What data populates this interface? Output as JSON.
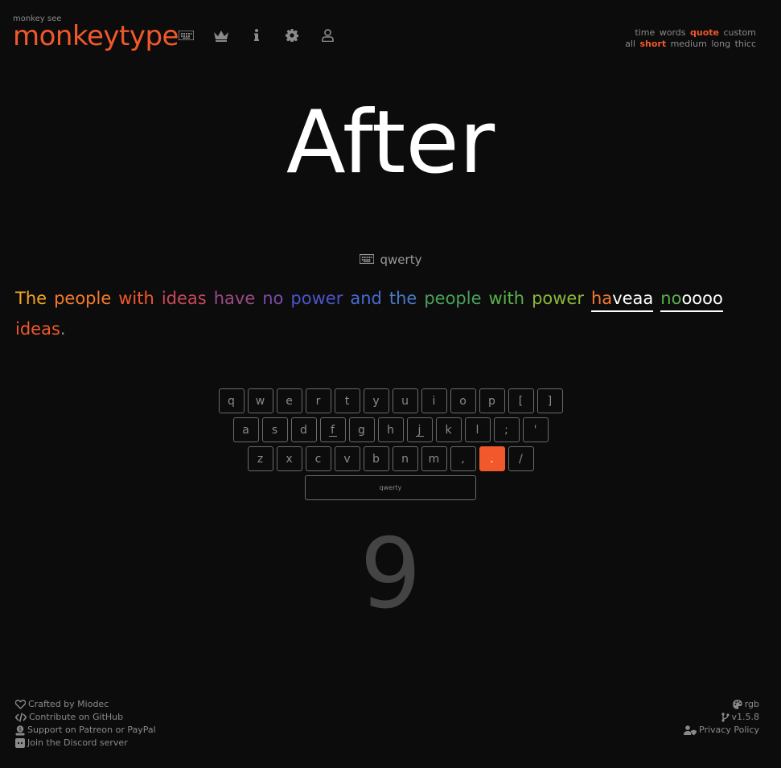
{
  "header": {
    "tagline": "monkey see",
    "logo": "monkeytype",
    "nav": [
      {
        "name": "keyboard-icon"
      },
      {
        "name": "crown-icon"
      },
      {
        "name": "info-icon"
      },
      {
        "name": "gear-icon"
      },
      {
        "name": "user-icon"
      }
    ]
  },
  "config": {
    "modes": [
      "time",
      "words",
      "quote",
      "custom"
    ],
    "active_mode": "quote",
    "lengths": [
      "all",
      "short",
      "medium",
      "long",
      "thicc"
    ],
    "active_length": "short"
  },
  "big_word": "After",
  "layout_label": "qwerty",
  "words": [
    {
      "text": "The",
      "color": "#f5a623"
    },
    {
      "text": "people",
      "color": "#f47a2e"
    },
    {
      "text": "with",
      "color": "#f1582b"
    },
    {
      "text": "ideas",
      "color": "#c8485b"
    },
    {
      "text": "have",
      "color": "#9b4a86"
    },
    {
      "text": "no",
      "color": "#7a4aa6"
    },
    {
      "text": "power",
      "color": "#4a55c8"
    },
    {
      "text": "and",
      "color": "#4a6ad0"
    },
    {
      "text": "the",
      "color": "#4a7ac8"
    },
    {
      "text": "people",
      "color": "#4aa05a"
    },
    {
      "text": "with",
      "color": "#5ab04a"
    },
    {
      "text": "power",
      "color": "#8ab83a"
    }
  ],
  "typed_word_1": {
    "correct": "ha",
    "extra": "veaa"
  },
  "typed_word_2": {
    "correct": "no",
    "extra": "oooo"
  },
  "last_word": "ideas",
  "last_punct": ".",
  "keyboard": {
    "row1": [
      "q",
      "w",
      "e",
      "r",
      "t",
      "y",
      "u",
      "i",
      "o",
      "p",
      "[",
      "]"
    ],
    "row2": [
      "a",
      "s",
      "d",
      "f",
      "g",
      "h",
      "j",
      "k",
      "l",
      ";",
      "'"
    ],
    "row3": [
      "z",
      "x",
      "c",
      "v",
      "b",
      "n",
      "m",
      ",",
      ".",
      "/"
    ],
    "space": "qwerty",
    "highlighted": "."
  },
  "counter": "9",
  "footer": {
    "left": [
      {
        "icon": "heart-icon",
        "label": "Crafted by Miodec"
      },
      {
        "icon": "code-icon",
        "label": "Contribute on GitHub"
      },
      {
        "icon": "donate-icon",
        "label": "Support on Patreon or PayPal"
      },
      {
        "icon": "discord-icon",
        "label": "Join the Discord server"
      }
    ],
    "right": [
      {
        "icon": "palette-icon",
        "label": "rgb"
      },
      {
        "icon": "branch-icon",
        "label": "v1.5.8"
      },
      {
        "icon": "user-shield-icon",
        "label": "Privacy Policy"
      }
    ]
  },
  "colors": {
    "accent": "#f1582b",
    "bg": "#0c0c0c",
    "text": "#8a8a8a"
  }
}
